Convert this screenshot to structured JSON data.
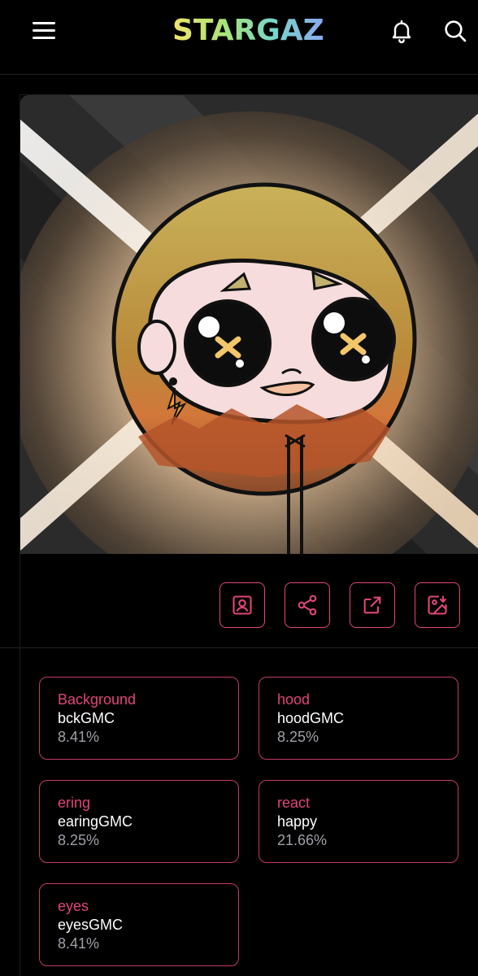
{
  "header": {
    "logo_text": "STARGAZE",
    "icons": [
      "menu-icon",
      "bell-icon",
      "search-icon"
    ]
  },
  "actions": [
    "profile-icon",
    "share-icon",
    "external-link-icon",
    "download-image-icon"
  ],
  "traits": [
    {
      "name": "Background",
      "value": "bckGMC",
      "percent": "8.41%"
    },
    {
      "name": "hood",
      "value": "hoodGMC",
      "percent": "8.25%"
    },
    {
      "name": "ering",
      "value": "earingGMC",
      "percent": "8.25%"
    },
    {
      "name": "react",
      "value": "happy",
      "percent": "21.66%"
    },
    {
      "name": "eyes",
      "value": "eyesGMC",
      "percent": "8.41%"
    }
  ],
  "colors": {
    "accent": "#e0457b",
    "background": "#000000",
    "muted_text": "#a0a0a8"
  }
}
